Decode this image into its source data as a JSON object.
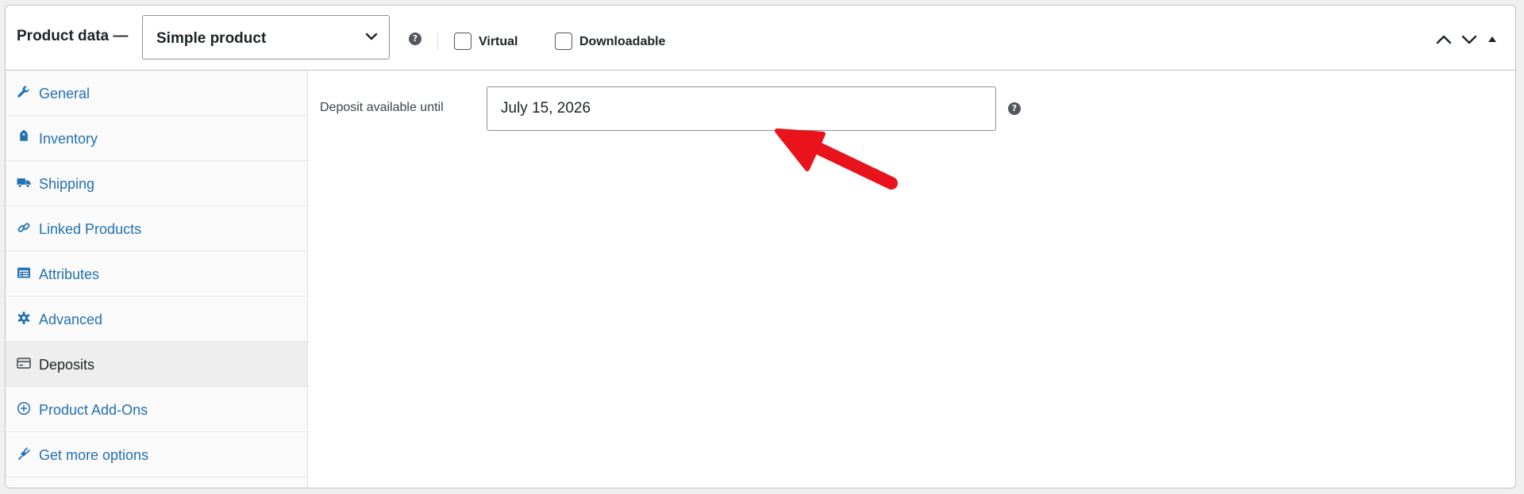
{
  "header": {
    "title": "Product data —",
    "product_type": {
      "selected": "Simple product",
      "icon": "chevron-down-icon"
    },
    "help_icon": "question-circle-icon",
    "help_glyph": "?",
    "checkboxes": [
      {
        "label": "Virtual",
        "checked": false
      },
      {
        "label": "Downloadable",
        "checked": false
      }
    ],
    "controls": [
      "chevron-up-icon",
      "chevron-down-icon",
      "triangle-up-icon"
    ]
  },
  "sidebar": {
    "items": [
      {
        "label": "General",
        "icon": "wrench-icon",
        "active": false
      },
      {
        "label": "Inventory",
        "icon": "tag-icon",
        "active": false
      },
      {
        "label": "Shipping",
        "icon": "truck-icon",
        "active": false
      },
      {
        "label": "Linked Products",
        "icon": "link-icon",
        "active": false
      },
      {
        "label": "Attributes",
        "icon": "list-icon",
        "active": false
      },
      {
        "label": "Advanced",
        "icon": "gear-icon",
        "active": false
      },
      {
        "label": "Deposits",
        "icon": "card-icon",
        "active": true
      },
      {
        "label": "Product Add-Ons",
        "icon": "plus-circle-icon",
        "active": false
      },
      {
        "label": "Get more options",
        "icon": "plugin-icon",
        "active": false
      }
    ]
  },
  "deposits": {
    "field_label": "Deposit available until",
    "field_value": "July 15, 2026",
    "help_icon": "question-circle-icon",
    "help_glyph": "?"
  },
  "colors": {
    "link": "#2271b1",
    "text": "#1d2327",
    "border": "#c3c4c7",
    "annotation_arrow": "#e8131b",
    "active_tab_bg": "#eeeeee"
  }
}
